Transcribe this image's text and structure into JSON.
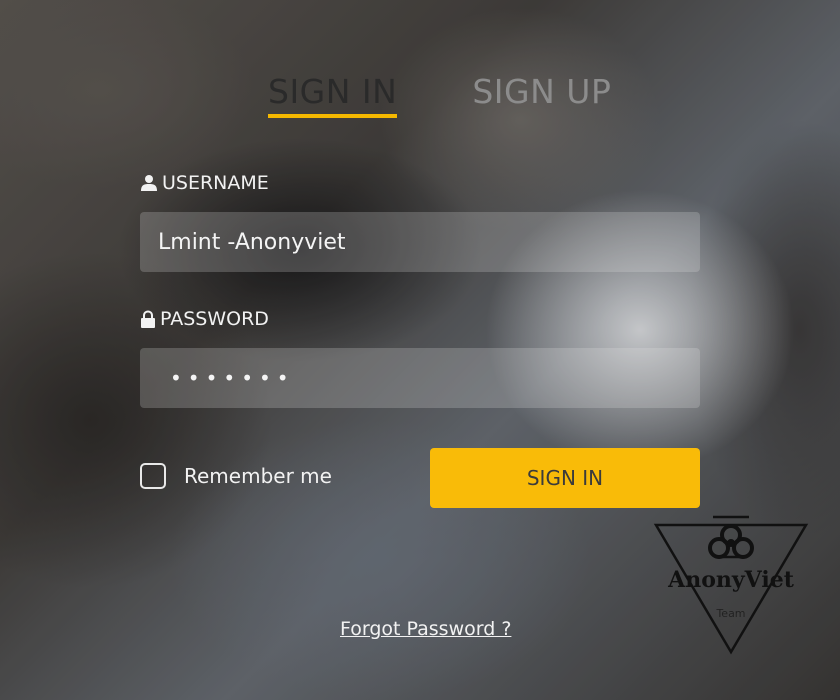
{
  "tabs": {
    "sign_in": "SIGN IN",
    "sign_up": "SIGN UP"
  },
  "username": {
    "label": "USERNAME",
    "value": "Lmint -Anonyviet",
    "icon": "user-icon"
  },
  "password": {
    "label": "PASSWORD",
    "masked_value": "•••••••",
    "icon": "lock-icon"
  },
  "remember": {
    "label": "Remember me",
    "checked": false
  },
  "submit_label": "SIGN IN",
  "forgot_label": "Forgot Password ?",
  "logo": {
    "name": "AnonyViet",
    "subtitle": "Team"
  },
  "colors": {
    "accent": "#f9bb08",
    "active_tab_text": "#2a2a2a",
    "inactive_tab_text": "#8c8c8c"
  }
}
